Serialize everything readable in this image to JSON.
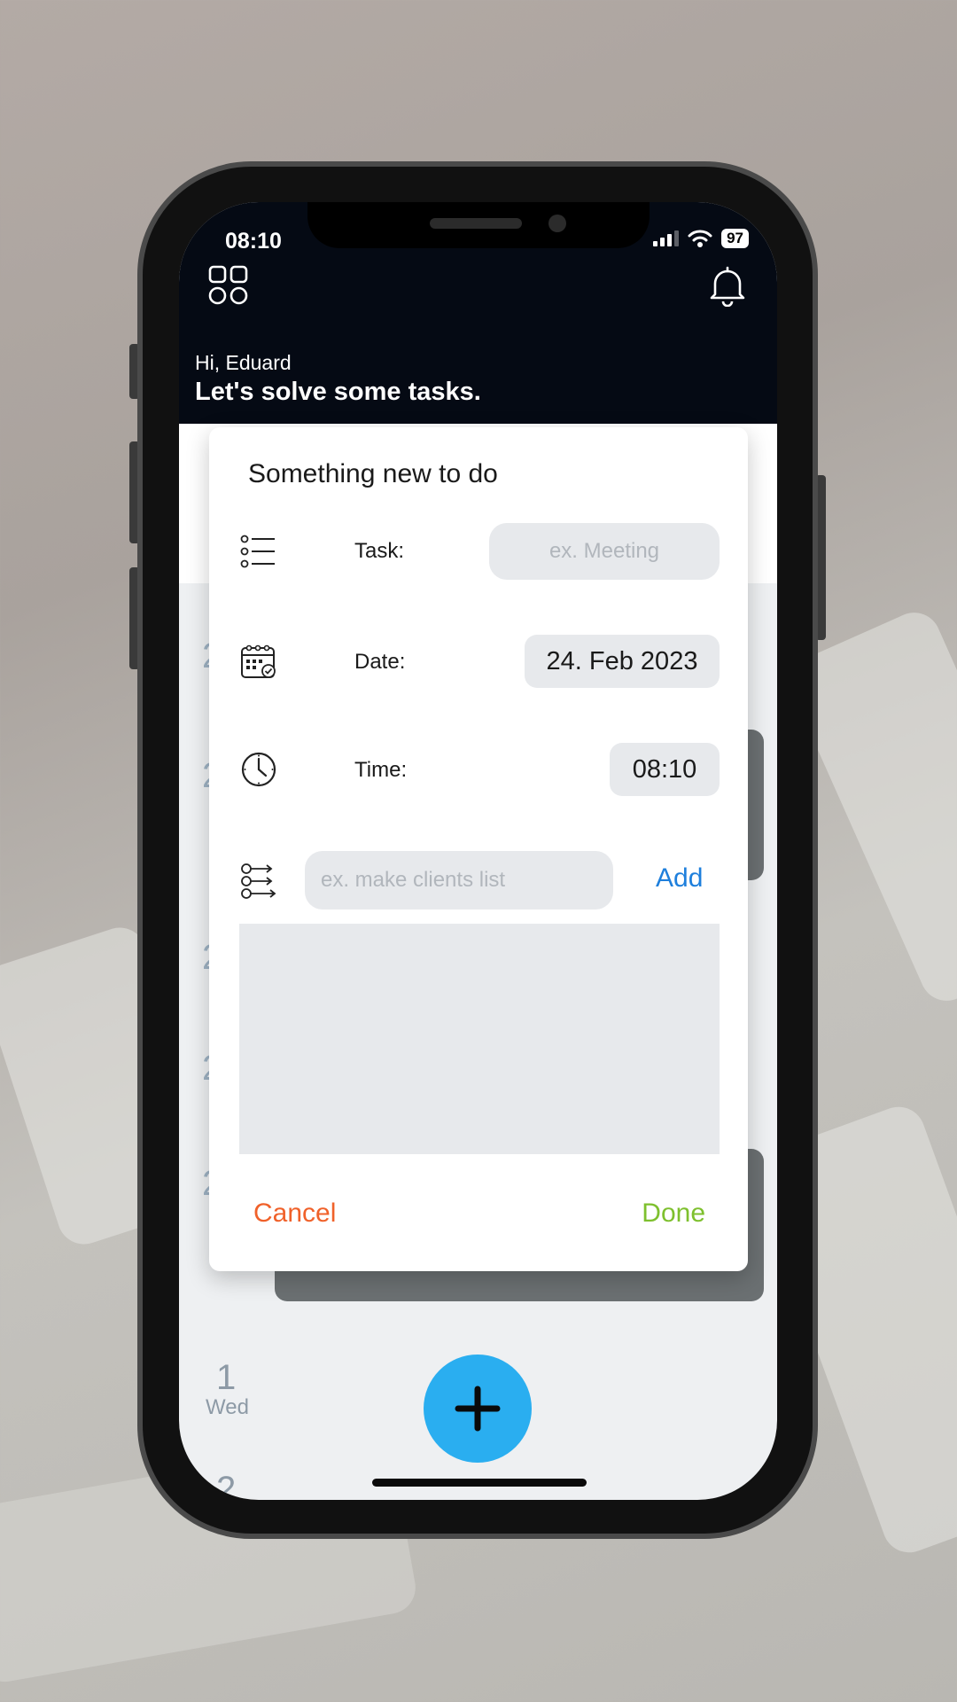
{
  "status_bar": {
    "time": "08:10",
    "battery": "97"
  },
  "header": {
    "greeting": "Hi, Eduard",
    "headline": "Let's solve some tasks."
  },
  "modal": {
    "title": "Something new to do",
    "task": {
      "label": "Task:",
      "placeholder": "ex. Meeting"
    },
    "date": {
      "label": "Date:",
      "value": "24. Feb 2023"
    },
    "time": {
      "label": "Time:",
      "value": "08:10"
    },
    "subtask": {
      "placeholder": "ex. make clients list",
      "add_label": "Add"
    },
    "cancel_label": "Cancel",
    "done_label": "Done"
  },
  "calendar": {
    "day_number": "1",
    "day_name": "Wed",
    "next_day_number": "2"
  },
  "colors": {
    "accent_blue": "#2aaef0",
    "link_blue": "#1e7fdc",
    "cancel_orange": "#f0612a",
    "done_green": "#7ec02e",
    "header_dark": "#050a14"
  },
  "icons": [
    "grid-menu-icon",
    "bell-icon",
    "list-icon",
    "calendar-icon",
    "clock-icon",
    "subtask-list-icon",
    "plus-icon",
    "signal-icon",
    "wifi-icon"
  ]
}
